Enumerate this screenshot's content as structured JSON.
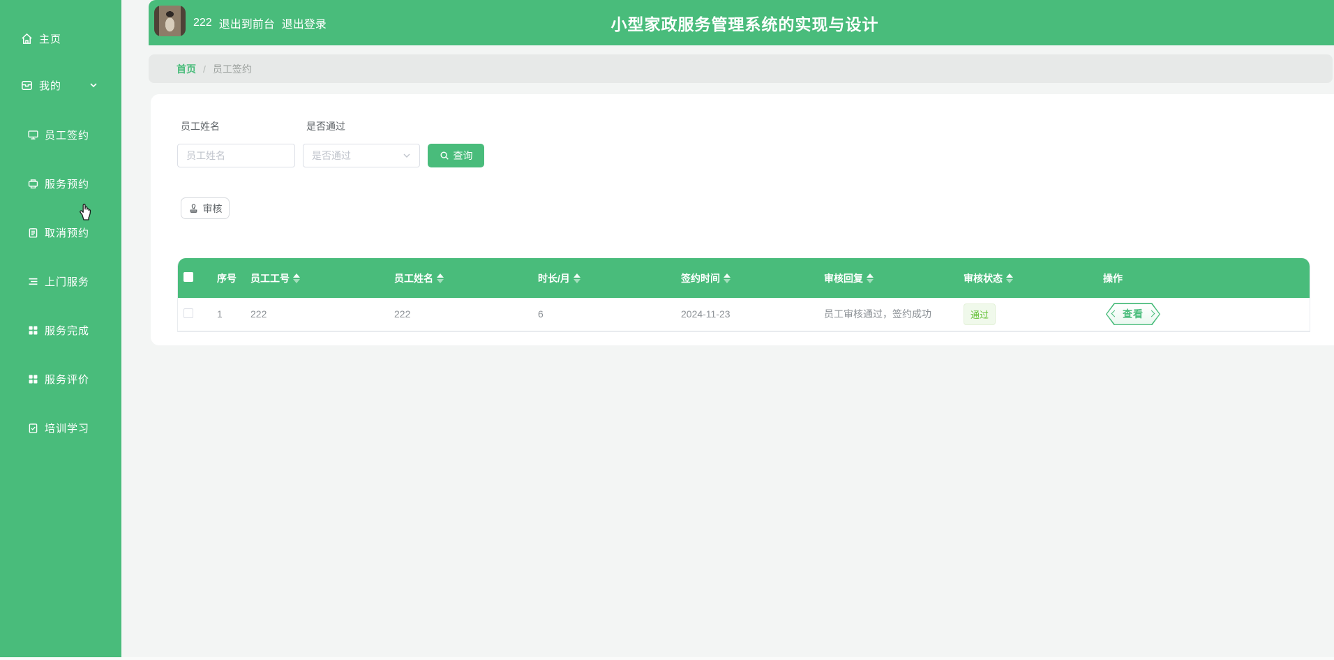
{
  "app": {
    "title": "小型家政服务管理系统的实现与设计",
    "username": "222",
    "back_to_front": "退出到前台",
    "logout": "退出登录"
  },
  "sidebar": {
    "items": [
      {
        "label": "主页",
        "icon": "home-icon"
      },
      {
        "label": "我的",
        "icon": "card-icon"
      },
      {
        "label": "员工签约",
        "icon": "monitor-icon"
      },
      {
        "label": "服务预约",
        "icon": "printer-icon"
      },
      {
        "label": "取消预约",
        "icon": "clipboard-icon"
      },
      {
        "label": "上门服务",
        "icon": "list-icon"
      },
      {
        "label": "服务完成",
        "icon": "grid-icon"
      },
      {
        "label": "服务评价",
        "icon": "grid-icon"
      },
      {
        "label": "培训学习",
        "icon": "clipboard-check-icon"
      }
    ]
  },
  "breadcrumb": {
    "home": "首页",
    "separator": "/",
    "current": "员工签约"
  },
  "filters": {
    "name_label": "员工姓名",
    "name_placeholder": "员工姓名",
    "pass_label": "是否通过",
    "pass_placeholder": "是否通过",
    "search_label": "查询"
  },
  "toolbar": {
    "audit_label": "审核"
  },
  "table": {
    "columns": [
      {
        "label": "",
        "sortable": false
      },
      {
        "label": "序号",
        "sortable": false
      },
      {
        "label": "员工工号",
        "sortable": true
      },
      {
        "label": "员工姓名",
        "sortable": true
      },
      {
        "label": "时长/月",
        "sortable": true
      },
      {
        "label": "签约时间",
        "sortable": true
      },
      {
        "label": "审核回复",
        "sortable": true
      },
      {
        "label": "审核状态",
        "sortable": true
      },
      {
        "label": "操作",
        "sortable": false
      }
    ],
    "rows": [
      {
        "seq": "1",
        "emp_id": "222",
        "emp_name": "222",
        "duration": "6",
        "sign_date": "2024-11-23",
        "reply": "员工审核通过，签约成功",
        "status": "通过",
        "action": "查看"
      }
    ]
  },
  "colors": {
    "theme_green": "#49bc7b",
    "page_bg": "#f3f5f4",
    "breadcrumb_bg": "#e7e9e8",
    "badge_bg": "#f0f9eb",
    "badge_text": "#67c23a"
  }
}
